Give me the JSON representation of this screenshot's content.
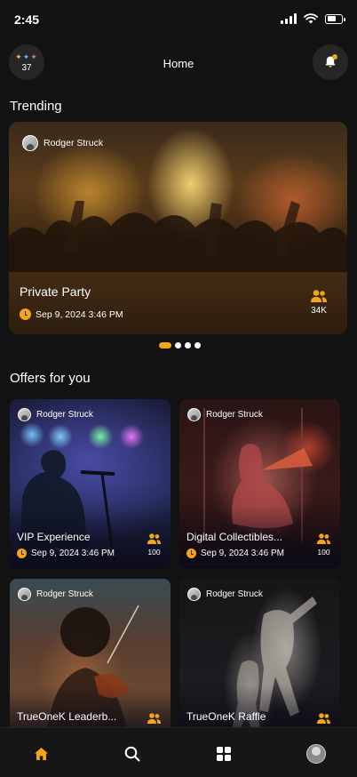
{
  "status_bar": {
    "time": "2:45",
    "battery_level": 0.65
  },
  "header": {
    "badge_count": "37",
    "title": "Home"
  },
  "trending": {
    "section_title": "Trending",
    "card": {
      "owner": "Rodger Struck",
      "title": "Private Party",
      "datetime": "Sep 9, 2024 3:46 PM",
      "attendees": "34K"
    },
    "pagination": {
      "total": 4,
      "active": 1
    }
  },
  "offers": {
    "section_title": "Offers for you",
    "items": [
      {
        "owner": "Rodger Struck",
        "title": "VIP Experience",
        "datetime": "Sep 9, 2024 3:46 PM",
        "attendees": "100"
      },
      {
        "owner": "Rodger Struck",
        "title": "Digital Collectibles...",
        "datetime": "Sep 9, 2024 3:46 PM",
        "attendees": "100"
      },
      {
        "owner": "Rodger Struck",
        "title": "TrueOneK Leaderb...",
        "datetime": "",
        "attendees": ""
      },
      {
        "owner": "Rodger Struck",
        "title": "TrueOneK Raffle",
        "datetime": "",
        "attendees": ""
      }
    ]
  },
  "tabbar": {
    "items": [
      "home-icon",
      "search-icon",
      "grid-icon",
      "profile-avatar"
    ],
    "active": "home"
  },
  "colors": {
    "accent": "#f2a51a",
    "background": "#121212"
  }
}
